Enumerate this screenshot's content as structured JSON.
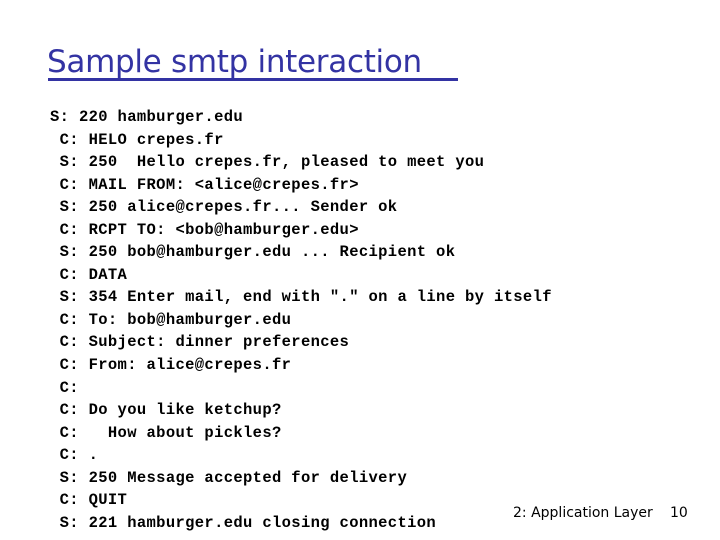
{
  "slide": {
    "title": "Sample smtp interaction",
    "title_color": "#3333a3",
    "background_color": "#ffffff",
    "body_color": "#000000"
  },
  "transcript": {
    "lines": [
      "S: 220 hamburger.edu",
      " C: HELO crepes.fr",
      " S: 250  Hello crepes.fr, pleased to meet you",
      " C: MAIL FROM: <alice@crepes.fr>",
      " S: 250 alice@crepes.fr... Sender ok",
      " C: RCPT TO: <bob@hamburger.edu>",
      " S: 250 bob@hamburger.edu ... Recipient ok",
      " C: DATA",
      " S: 354 Enter mail, end with \".\" on a line by itself",
      " C: To: bob@hamburger.edu",
      " C: Subject: dinner preferences",
      " C: From: alice@crepes.fr",
      " C:",
      " C: Do you like ketchup?",
      " C:   How about pickles?",
      " C: .",
      " S: 250 Message accepted for delivery",
      " C: QUIT",
      " S: 221 hamburger.edu closing connection"
    ]
  },
  "footer": {
    "chapter_label": "2: Application Layer",
    "page_number": "10"
  }
}
